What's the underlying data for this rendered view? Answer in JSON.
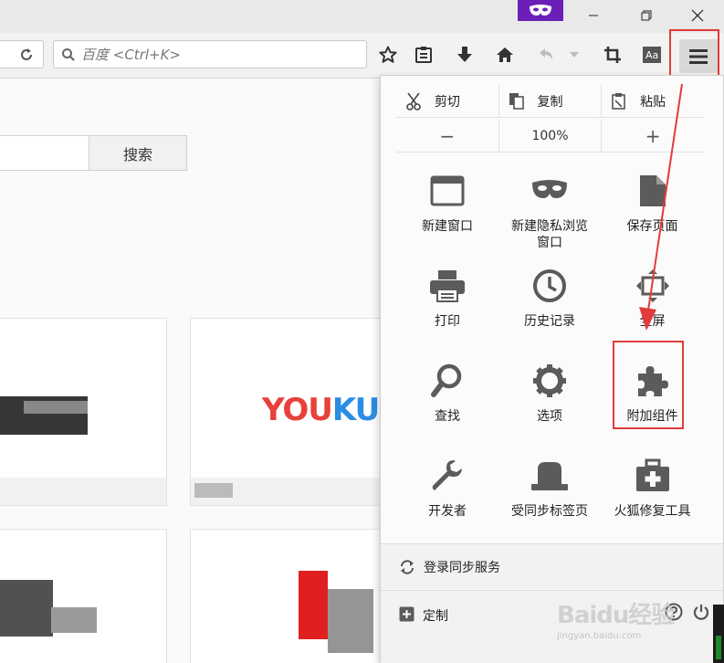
{
  "toolbar": {
    "search_placeholder": "百度 <Ctrl+K>"
  },
  "page": {
    "search_button": "搜索"
  },
  "menu": {
    "edit": {
      "cut": "剪切",
      "copy": "复制",
      "paste": "粘贴"
    },
    "zoom": {
      "minus": "−",
      "level": "100%",
      "plus": "+"
    },
    "items": [
      {
        "label": "新建窗口",
        "icon": "new-window-icon"
      },
      {
        "label": "新建隐私浏览\n窗口",
        "icon": "private-mask-icon"
      },
      {
        "label": "保存页面",
        "icon": "save-page-icon"
      },
      {
        "label": "打印",
        "icon": "print-icon"
      },
      {
        "label": "历史记录",
        "icon": "history-clock-icon"
      },
      {
        "label": "全屏",
        "icon": "fullscreen-icon"
      },
      {
        "label": "查找",
        "icon": "find-magnifier-icon"
      },
      {
        "label": "选项",
        "icon": "options-gear-icon"
      },
      {
        "label": "附加组件",
        "icon": "addons-puzzle-icon"
      },
      {
        "label": "开发者",
        "icon": "developer-wrench-icon"
      },
      {
        "label": "受同步标签页",
        "icon": "synced-tabs-icon"
      },
      {
        "label": "火狐修复工具",
        "icon": "repair-kit-icon"
      }
    ],
    "sync": "登录同步服务",
    "customize": "定制"
  },
  "watermark": {
    "brand": "Baidu经验",
    "sub": "jingyan.baidu.com"
  },
  "colors": {
    "annotation": "#e23b3b",
    "icon": "#5b5b5b",
    "private": "#6a1fb8"
  }
}
